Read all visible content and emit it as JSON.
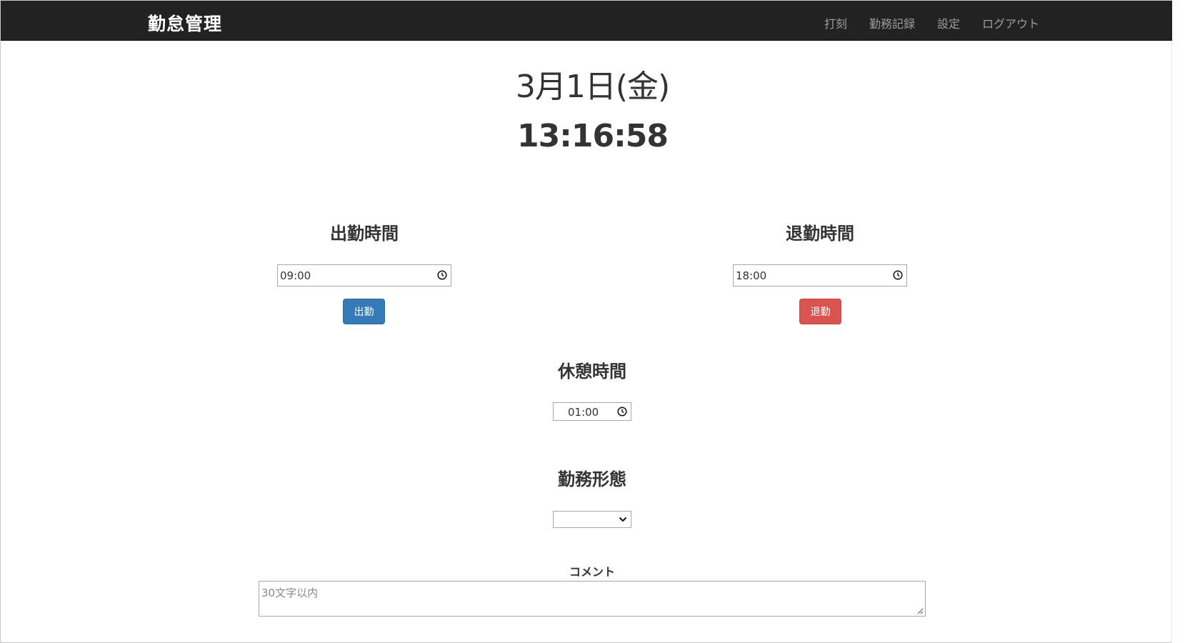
{
  "navbar": {
    "brand": "勤怠管理",
    "links": [
      "打刻",
      "勤務記録",
      "設定",
      "ログアウト"
    ]
  },
  "clock": {
    "date": "3月1日(金)",
    "time": "13:16:58"
  },
  "clock_in": {
    "heading": "出勤時間",
    "time_value": "09:00",
    "button_label": "出勤",
    "button_color": "#337ab7"
  },
  "clock_out": {
    "heading": "退勤時間",
    "time_value": "18:00",
    "button_label": "退勤",
    "button_color": "#d9534f"
  },
  "break_time": {
    "heading": "休憩時間",
    "time_value": "01:00"
  },
  "work_type": {
    "heading": "勤務形態",
    "selected": ""
  },
  "comment": {
    "label": "コメント",
    "placeholder": "30文字以内"
  },
  "colors": {
    "navbar_bg": "#222222",
    "nav_link": "#9d9d9d",
    "text": "#333333"
  }
}
